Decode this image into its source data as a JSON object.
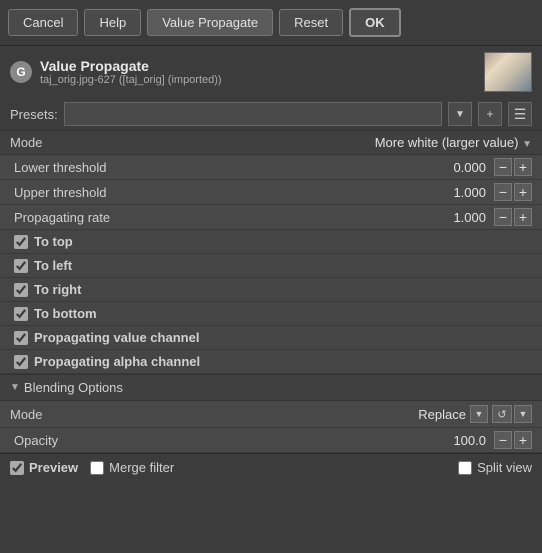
{
  "toolbar": {
    "cancel_label": "Cancel",
    "help_label": "Help",
    "active_label": "Value Propagate",
    "reset_label": "Reset",
    "ok_label": "OK"
  },
  "header": {
    "icon_letter": "G",
    "title": "Value Propagate",
    "subtitle": "taj_orig.jpg-627 ([taj_orig] (imported))"
  },
  "presets": {
    "label": "Presets:",
    "value": "",
    "placeholder": ""
  },
  "mode": {
    "label": "Mode",
    "value": "More white (larger value)"
  },
  "params": [
    {
      "label": "Lower threshold",
      "value": "0.000"
    },
    {
      "label": "Upper threshold",
      "value": "1.000"
    },
    {
      "label": "Propagating rate",
      "value": "1.000"
    }
  ],
  "checkboxes": [
    {
      "label": "To top",
      "checked": true
    },
    {
      "label": "To left",
      "checked": true
    },
    {
      "label": "To right",
      "checked": true
    },
    {
      "label": "To bottom",
      "checked": true
    },
    {
      "label": "Propagating value channel",
      "checked": true
    },
    {
      "label": "Propagating alpha channel",
      "checked": true
    }
  ],
  "blending": {
    "section_title": "Blending Options",
    "mode_label": "Mode",
    "mode_value": "Replace",
    "opacity_label": "Opacity",
    "opacity_value": "100.0"
  },
  "bottom": {
    "preview_label": "Preview",
    "preview_checked": true,
    "merge_filter_label": "Merge filter",
    "merge_filter_checked": false,
    "split_view_label": "Split view",
    "split_view_checked": false
  }
}
